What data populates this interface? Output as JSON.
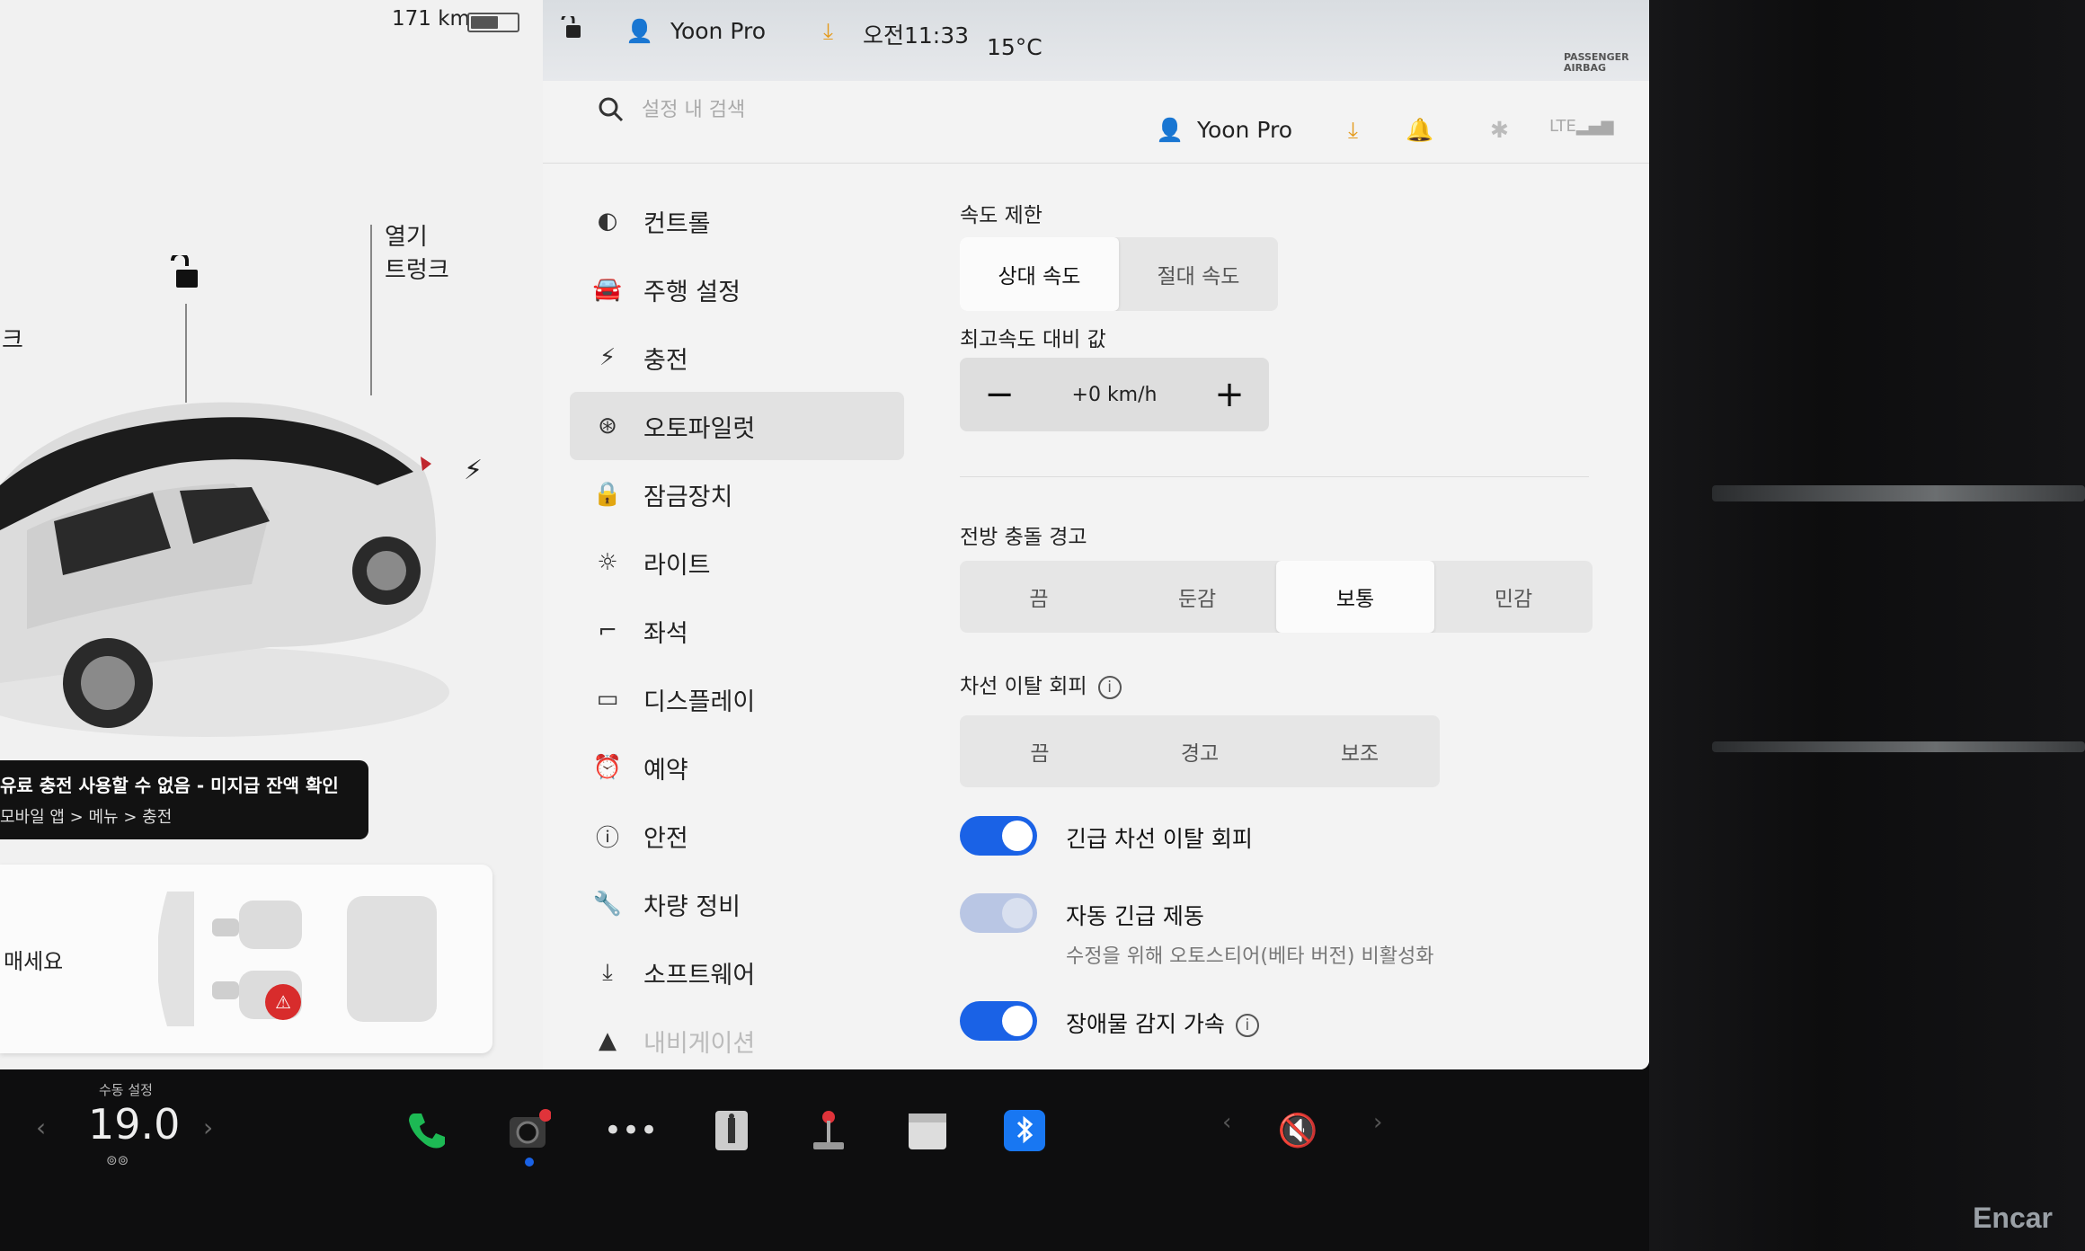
{
  "left_panel": {
    "range": "171 km",
    "trunk_label_line1": "열기",
    "trunk_label_line2": "트렁크",
    "left_edge_label": "크",
    "toast_title": "유료 충전 사용할 수 없음 - 미지급 잔액 확인",
    "toast_sub": "모바일 앱 > 메뉴 > 충전",
    "seat_label": "매세요"
  },
  "topbar": {
    "user": "Yoon Pro",
    "time": "오전11:33",
    "temperature": "15°C",
    "airbag_line1": "PASSENGER",
    "airbag_line2": "AIRBAG"
  },
  "settings": {
    "search_placeholder": "설정 내 검색",
    "header_user": "Yoon Pro",
    "menu": [
      {
        "label": "컨트롤",
        "icon": "toggle-icon"
      },
      {
        "label": "주행 설정",
        "icon": "car-icon"
      },
      {
        "label": "충전",
        "icon": "bolt-icon"
      },
      {
        "label": "오토파일럿",
        "icon": "steering-wheel-icon",
        "active": true
      },
      {
        "label": "잠금장치",
        "icon": "lock-icon"
      },
      {
        "label": "라이트",
        "icon": "light-icon"
      },
      {
        "label": "좌석",
        "icon": "seat-icon"
      },
      {
        "label": "디스플레이",
        "icon": "display-icon"
      },
      {
        "label": "예약",
        "icon": "alarm-icon"
      },
      {
        "label": "안전",
        "icon": "info-icon"
      },
      {
        "label": "차량 정비",
        "icon": "wrench-icon"
      },
      {
        "label": "소프트웨어",
        "icon": "download-icon"
      },
      {
        "label": "내비게이션",
        "icon": "navigation-icon"
      }
    ],
    "speed_limit": {
      "label": "속도 제한",
      "options": [
        "상대 속도",
        "절대 속도"
      ],
      "selected": 0
    },
    "offset": {
      "label": "최고속도 대비 값",
      "value": "+0 km/h",
      "minus": "−",
      "plus": "+"
    },
    "fcw": {
      "label": "전방 충돌 경고",
      "options": [
        "끔",
        "둔감",
        "보통",
        "민감"
      ],
      "selected": 2
    },
    "lane": {
      "label": "차선 이탈 회피",
      "info": "i",
      "options": [
        "끔",
        "경고",
        "보조"
      ],
      "selected": -1
    },
    "emergency_lane": {
      "label": "긴급 차선 이탈 회피",
      "on": true
    },
    "aeb": {
      "label": "자동 긴급 제동",
      "sub": "수정을 위해 오토스티어(베타 버전) 비활성화",
      "on": true,
      "disabled": true
    },
    "obstacle": {
      "label": "장애물 감지 가속",
      "info": "i",
      "on": true
    }
  },
  "dock": {
    "temp_label": "수동 설정",
    "temp_value": "19.0",
    "icons": [
      "phone-icon",
      "camera-icon",
      "more-icon",
      "manual-icon",
      "joystick-icon",
      "calendar-icon",
      "bluetooth-icon"
    ],
    "volume": "mute"
  },
  "watermark": "Encar",
  "colors": {
    "accent": "#1a62e6",
    "phone": "#1db954",
    "bluetooth": "#1877f2"
  }
}
